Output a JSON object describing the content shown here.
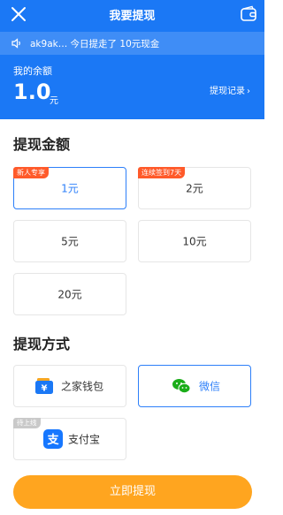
{
  "header": {
    "title": "我要提现",
    "notice": "ak9ak… 今日提走了 10元现金",
    "balance_label": "我的余额",
    "balance_amount": "1.0",
    "balance_unit": "元",
    "records_link": "提现记录"
  },
  "amount_section": {
    "title": "提现金额",
    "options": [
      {
        "label": "1元",
        "tag": "新人专享",
        "selected": true
      },
      {
        "label": "2元",
        "tag": "连续签到7天",
        "selected": false
      },
      {
        "label": "5元",
        "tag": "",
        "selected": false
      },
      {
        "label": "10元",
        "tag": "",
        "selected": false
      },
      {
        "label": "20元",
        "tag": "",
        "selected": false
      }
    ]
  },
  "method_section": {
    "title": "提现方式",
    "methods": [
      {
        "label": "之家钱包",
        "icon": "wallet-icon",
        "tag": "",
        "selected": false
      },
      {
        "label": "微信",
        "icon": "wechat-icon",
        "tag": "",
        "selected": true
      },
      {
        "label": "支付宝",
        "icon": "alipay-icon",
        "tag": "待上线",
        "selected": false
      }
    ]
  },
  "submit_label": "立即提现",
  "colors": {
    "header_blue": "#1b78f5",
    "selected_blue": "#2d7ff9",
    "tag_orange": "#ff5a2a",
    "button_orange": "#ffa51f",
    "wechat_green": "#1aad19",
    "alipay_blue": "#1677ff"
  }
}
